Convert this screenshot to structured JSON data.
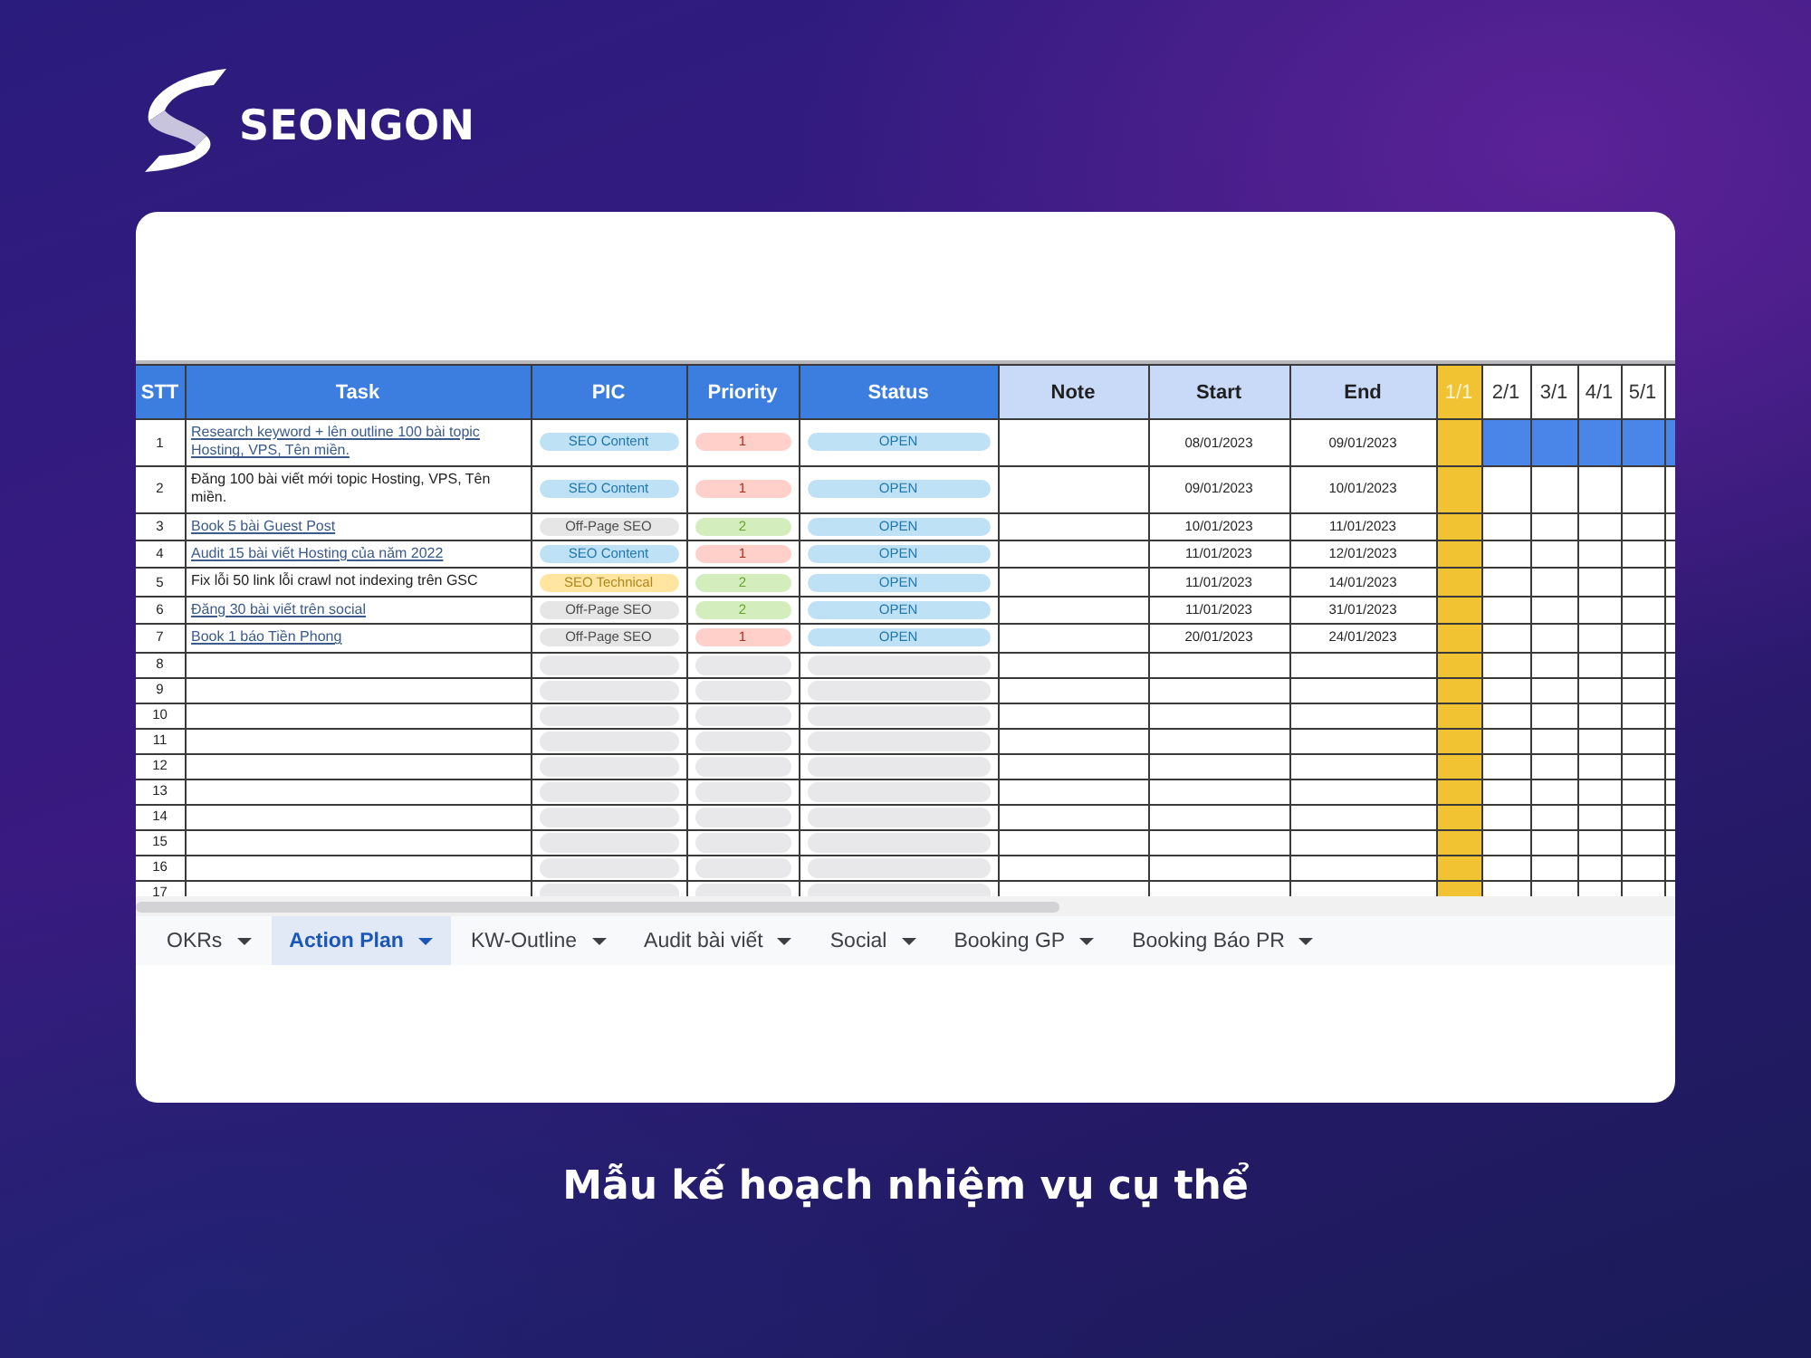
{
  "brand": {
    "name": "SEONGON"
  },
  "sheet": {
    "columns": [
      {
        "label": "STT",
        "kind": "primary"
      },
      {
        "label": "Task",
        "kind": "primary"
      },
      {
        "label": "PIC",
        "kind": "primary"
      },
      {
        "label": "Priority",
        "kind": "primary"
      },
      {
        "label": "Status",
        "kind": "primary"
      },
      {
        "label": "Note",
        "kind": "secondary"
      },
      {
        "label": "Start",
        "kind": "secondary"
      },
      {
        "label": "End",
        "kind": "secondary"
      }
    ],
    "days": [
      {
        "label": "1/1",
        "today": true
      },
      {
        "label": "2/1",
        "today": false
      },
      {
        "label": "3/1",
        "today": false
      },
      {
        "label": "4/1",
        "today": false
      },
      {
        "label": "5/1",
        "today": false
      },
      {
        "today": false
      }
    ],
    "rows": [
      {
        "stt": "1",
        "task": "Research keyword + lên outline 100 bài topic Hosting, VPS, Tên miền.",
        "link": true,
        "pic": {
          "label": "SEO Content",
          "color": "#bfe1f6"
        },
        "priority": {
          "label": "1",
          "color": "#ffcfc9"
        },
        "status": {
          "label": "OPEN",
          "color": "#bfe1f6"
        },
        "start": "08/01/2023",
        "end": "09/01/2023",
        "timeline": [
          false,
          true,
          true,
          true,
          true,
          true
        ]
      },
      {
        "stt": "2",
        "task": "Đăng 100 bài viết mới topic Hosting, VPS, Tên miền.",
        "link": false,
        "pic": {
          "label": "SEO Content",
          "color": "#bfe1f6"
        },
        "priority": {
          "label": "1",
          "color": "#ffcfc9"
        },
        "status": {
          "label": "OPEN",
          "color": "#bfe1f6"
        },
        "start": "09/01/2023",
        "end": "10/01/2023",
        "timeline": [
          false,
          false,
          false,
          false,
          false,
          false
        ]
      },
      {
        "stt": "3",
        "task": "Book 5 bài Guest Post",
        "link": true,
        "pic": {
          "label": "Off-Page SEO",
          "color": "#e6e6e6"
        },
        "priority": {
          "label": "2",
          "color": "#d4edbc"
        },
        "status": {
          "label": "OPEN",
          "color": "#bfe1f6"
        },
        "start": "10/01/2023",
        "end": "11/01/2023",
        "timeline": [
          false,
          false,
          false,
          false,
          false,
          false
        ]
      },
      {
        "stt": "4",
        "task": "Audit 15 bài viết Hosting của năm 2022",
        "link": true,
        "pic": {
          "label": "SEO Content",
          "color": "#bfe1f6"
        },
        "priority": {
          "label": "1",
          "color": "#ffcfc9"
        },
        "status": {
          "label": "OPEN",
          "color": "#bfe1f6"
        },
        "start": "11/01/2023",
        "end": "12/01/2023",
        "timeline": [
          false,
          false,
          false,
          false,
          false,
          false
        ]
      },
      {
        "stt": "5",
        "task": "Fix lỗi 50 link lỗi crawl not indexing trên GSC",
        "link": false,
        "pic": {
          "label": "SEO Technical",
          "color": "#ffe5a0"
        },
        "priority": {
          "label": "2",
          "color": "#d4edbc"
        },
        "status": {
          "label": "OPEN",
          "color": "#bfe1f6"
        },
        "start": "11/01/2023",
        "end": "14/01/2023",
        "timeline": [
          false,
          false,
          false,
          false,
          false,
          false
        ]
      },
      {
        "stt": "6",
        "task": "Đăng 30 bài viết trên social",
        "link": true,
        "pic": {
          "label": "Off-Page SEO",
          "color": "#e6e6e6"
        },
        "priority": {
          "label": "2",
          "color": "#d4edbc"
        },
        "status": {
          "label": "OPEN",
          "color": "#bfe1f6"
        },
        "start": "11/01/2023",
        "end": "31/01/2023",
        "timeline": [
          false,
          false,
          false,
          false,
          false,
          false
        ]
      },
      {
        "stt": "7",
        "task": "Book 1 báo Tiền Phong",
        "link": true,
        "pic": {
          "label": "Off-Page SEO",
          "color": "#e6e6e6"
        },
        "priority": {
          "label": "1",
          "color": "#ffcfc9"
        },
        "status": {
          "label": "OPEN",
          "color": "#bfe1f6"
        },
        "start": "20/01/2023",
        "end": "24/01/2023",
        "timeline": [
          false,
          false,
          false,
          false,
          false,
          false
        ]
      },
      {
        "stt": "8",
        "timeline": [
          false,
          false,
          false,
          false,
          false,
          false
        ]
      },
      {
        "stt": "9",
        "timeline": [
          false,
          false,
          false,
          false,
          false,
          false
        ]
      },
      {
        "stt": "10",
        "timeline": [
          false,
          false,
          false,
          false,
          false,
          false
        ]
      },
      {
        "stt": "11",
        "timeline": [
          false,
          false,
          false,
          false,
          false,
          false
        ]
      },
      {
        "stt": "12",
        "timeline": [
          false,
          false,
          false,
          false,
          false,
          false
        ]
      },
      {
        "stt": "13",
        "timeline": [
          false,
          false,
          false,
          false,
          false,
          false
        ]
      },
      {
        "stt": "14",
        "timeline": [
          false,
          false,
          false,
          false,
          false,
          false
        ]
      },
      {
        "stt": "15",
        "timeline": [
          false,
          false,
          false,
          false,
          false,
          false
        ]
      },
      {
        "stt": "16",
        "timeline": [
          false,
          false,
          false,
          false,
          false,
          false
        ]
      },
      {
        "stt": "17",
        "timeline": [
          false,
          false,
          false,
          false,
          false,
          false
        ]
      }
    ],
    "tabs": [
      {
        "label": "OKRs",
        "selected": false
      },
      {
        "label": "Action Plan",
        "selected": true
      },
      {
        "label": "KW-Outline",
        "selected": false
      },
      {
        "label": "Audit bài viết",
        "selected": false
      },
      {
        "label": "Social",
        "selected": false
      },
      {
        "label": "Booking GP",
        "selected": false
      },
      {
        "label": "Booking Báo PR",
        "selected": false
      }
    ]
  },
  "caption": "Mẫu kế hoạch nhiệm vụ cụ thể"
}
